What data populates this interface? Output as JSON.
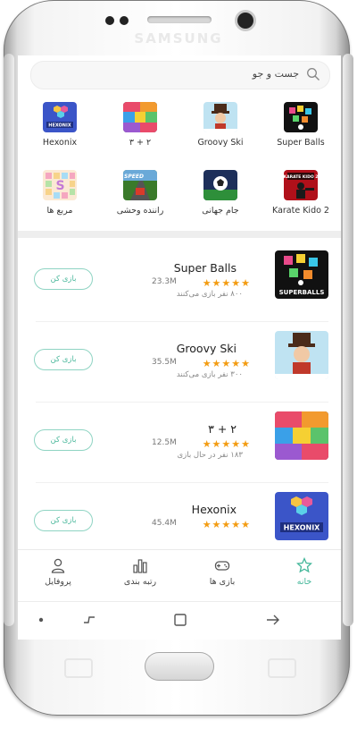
{
  "device": {
    "brand": "SAMSUNG"
  },
  "search": {
    "placeholder": "جست و جو"
  },
  "games_grid": [
    {
      "name": "Super Balls",
      "icon": "super-balls-icon"
    },
    {
      "name": "Groovy Ski",
      "icon": "groovy-ski-icon"
    },
    {
      "name": "۳ + ۲",
      "icon": "three-plus-two-icon"
    },
    {
      "name": "Hexonix",
      "icon": "hexonix-icon",
      "logo_text": "HEXONIX"
    },
    {
      "name": "Karate Kido 2",
      "icon": "karate-kido-icon",
      "logo_text": "KARATE KIDO 2"
    },
    {
      "name": "جام جهانی",
      "icon": "world-cup-icon"
    },
    {
      "name": "راننده وحشی",
      "icon": "wild-driver-icon",
      "logo_text": "SPEED"
    },
    {
      "name": "مربع ها",
      "icon": "squares-icon"
    }
  ],
  "game_list": [
    {
      "title": "Super Balls",
      "rating": "★★★★★",
      "downloads": "23.3M",
      "players": "۸۰۰ نفر بازی می‌کنند",
      "play_label": "بازی کن",
      "logo_text": "SUPERBALLS"
    },
    {
      "title": "Groovy Ski",
      "rating": "★★★★★",
      "downloads": "35.5M",
      "players": "۳۰۰ نفر بازی می‌کنند",
      "play_label": "بازی کن"
    },
    {
      "title": "۳ + ۲",
      "rating": "★★★★★",
      "downloads": "12.5M",
      "players": "۱۸۳ نفر در حال بازی",
      "play_label": "بازی کن"
    },
    {
      "title": "Hexonix",
      "rating": "★★★★★",
      "downloads": "45.4M",
      "players": "",
      "play_label": "بازی کن",
      "logo_text": "HEXONIX"
    }
  ],
  "bottom_nav": [
    {
      "label": "پروفایل",
      "icon": "user-icon"
    },
    {
      "label": "رتبه بندی",
      "icon": "bar-chart-icon"
    },
    {
      "label": "بازی ها",
      "icon": "gamepad-icon"
    },
    {
      "label": "خانه",
      "icon": "star-icon",
      "active": true
    }
  ],
  "colors": {
    "accent": "#44b79a",
    "star": "#f39c12",
    "play_border": "#8fd4c3"
  }
}
